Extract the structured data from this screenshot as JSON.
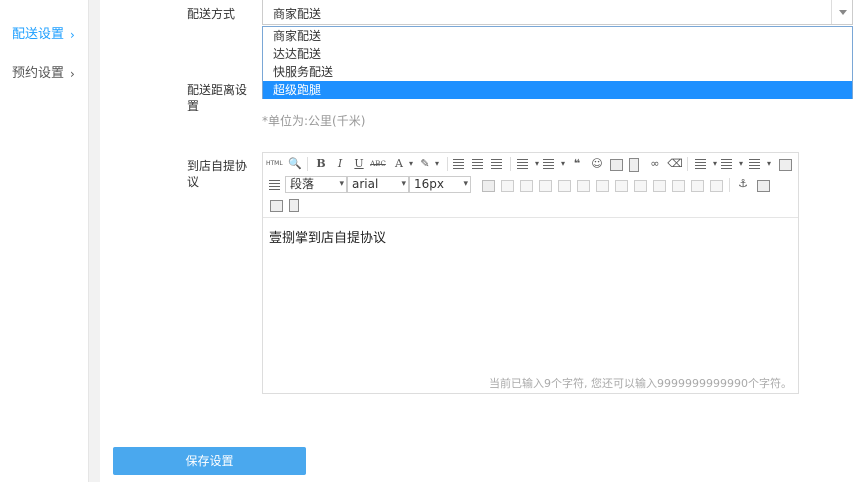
{
  "sidebar": {
    "items": [
      {
        "label": "配送设置",
        "active": true
      },
      {
        "label": "预约设置",
        "active": false
      }
    ]
  },
  "form": {
    "delivery_method": {
      "label": "配送方式",
      "value": "商家配送",
      "options": [
        "商家配送",
        "达达配送",
        "快服务配送",
        "超级跑腿"
      ],
      "highlighted": "超级跑腿"
    },
    "delivery_distance": {
      "label_line1": "配送距离设",
      "label_line2": "置",
      "hint": "*单位为:公里(千米)"
    },
    "pickup_agreement": {
      "label_line1": "到店自提协",
      "label_line2": "议",
      "content": "壹捌掌到店自提协议",
      "counter": "当前已输入9个字符, 您还可以输入9999999999990个字符。"
    }
  },
  "editor_toolbar": {
    "html_label": "HTML",
    "bold": "B",
    "italic": "I",
    "underline": "U",
    "strikethrough": "ABC",
    "font_color": "A",
    "quote": "❝",
    "paragraph_select": "段落",
    "font_family_select": "arial",
    "font_size_select": "16px"
  },
  "save_button": {
    "label": "保存设置"
  },
  "colors": {
    "accent": "#1e9fff",
    "highlight": "#1e90ff",
    "button": "#4aa8ee"
  }
}
